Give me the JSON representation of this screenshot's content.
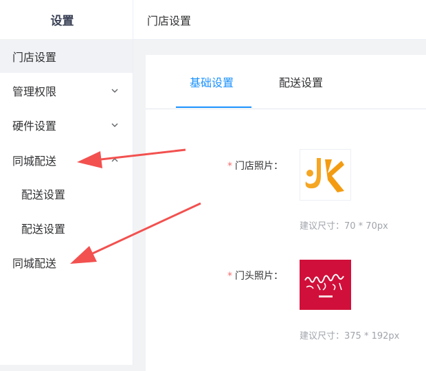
{
  "sidebar": {
    "title": "设置",
    "items": [
      {
        "label": "门店设置"
      },
      {
        "label": "管理权限"
      },
      {
        "label": "硬件设置"
      },
      {
        "label": "同城配送"
      },
      {
        "label": "配送设置"
      },
      {
        "label": "配送设置"
      },
      {
        "label": "同城配送"
      }
    ]
  },
  "header": {
    "breadcrumb": "门店设置"
  },
  "tabs": [
    {
      "label": "基础设置"
    },
    {
      "label": "配送设置"
    }
  ],
  "form": {
    "store_photo": {
      "required_mark": "*",
      "label": "门店照片：",
      "hint": "建议尺寸：70 * 70px"
    },
    "storefront_photo": {
      "required_mark": "*",
      "label": "门头照片：",
      "hint": "建议尺寸：375 * 192px"
    }
  },
  "colors": {
    "accent": "#1890ff",
    "arrow": "#f2514f",
    "required": "#f56c6c",
    "logo_orange": "#f5a623",
    "banner_red": "#d0103a"
  },
  "icons": [
    "chevron-down-icon",
    "chevron-up-icon",
    "arrow-annotation"
  ]
}
